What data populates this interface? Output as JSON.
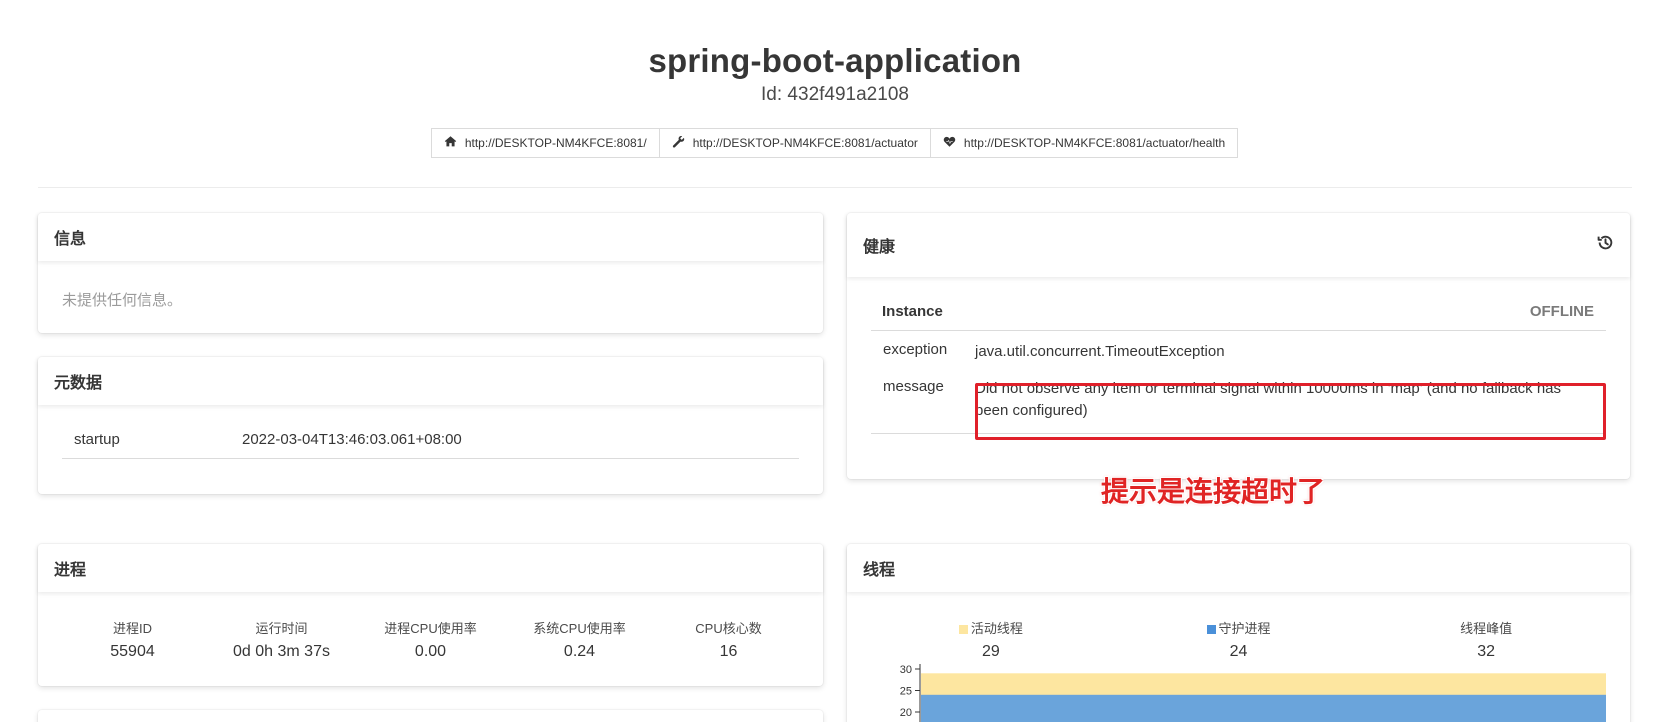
{
  "app": {
    "title": "spring-boot-application",
    "id_line": "Id: 432f491a2108"
  },
  "links": [
    {
      "icon": "home-icon",
      "label": "http://DESKTOP-NM4KFCE:8081/"
    },
    {
      "icon": "wrench-icon",
      "label": "http://DESKTOP-NM4KFCE:8081/actuator"
    },
    {
      "icon": "heartbeat-icon",
      "label": "http://DESKTOP-NM4KFCE:8081/actuator/health"
    }
  ],
  "info": {
    "title": "信息",
    "empty": "未提供任何信息。"
  },
  "metadata": {
    "title": "元数据",
    "rows": [
      {
        "key": "startup",
        "value": "2022-03-04T13:46:03.061+08:00"
      }
    ]
  },
  "health": {
    "title": "健康",
    "instance_label": "Instance",
    "status": "OFFLINE",
    "exception_key": "exception",
    "exception_value": "java.util.concurrent.TimeoutException",
    "message_key": "message",
    "message_value": "Did not observe any item or terminal signal within 10000ms in 'map' (and no fallback has been configured)"
  },
  "annotation": "提示是连接超时了",
  "process": {
    "title": "进程",
    "stats": [
      {
        "label": "进程ID",
        "value": "55904"
      },
      {
        "label": "运行时间",
        "value": "0d 0h 3m 37s"
      },
      {
        "label": "进程CPU使用率",
        "value": "0.00"
      },
      {
        "label": "系统CPU使用率",
        "value": "0.24"
      },
      {
        "label": "CPU核心数",
        "value": "16"
      }
    ]
  },
  "threads": {
    "title": "线程",
    "stats": [
      {
        "label": "活动线程",
        "value": "29",
        "color": "#fde6a0"
      },
      {
        "label": "守护进程",
        "value": "24",
        "color": "#4a90d9"
      },
      {
        "label": "线程峰值",
        "value": "32",
        "color": ""
      }
    ]
  },
  "chart_data": {
    "type": "area",
    "series": [
      {
        "name": "活动线程",
        "values": [
          29,
          29
        ],
        "color": "#fde6a0"
      },
      {
        "name": "守护进程",
        "values": [
          24,
          24
        ],
        "color": "#6aa4db"
      }
    ],
    "y_ticks": [
      "30",
      "25",
      "20"
    ],
    "ylim": [
      15,
      30
    ]
  }
}
